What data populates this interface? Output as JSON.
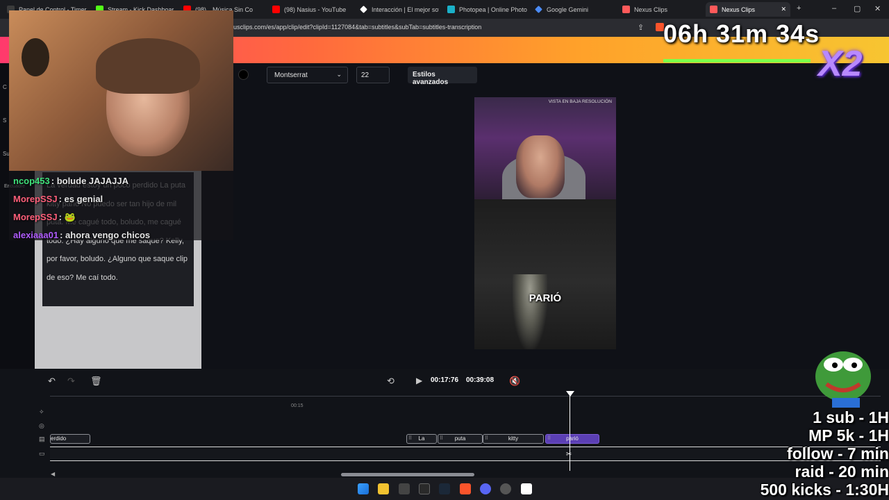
{
  "browser": {
    "tabs": [
      {
        "label": "Panel de Control - Timer",
        "color": "#e8e8e8"
      },
      {
        "label": "Stream - Kick Dashboard",
        "color": "#53fc18"
      },
      {
        "label": "(98)",
        "color": "#ff0000"
      },
      {
        "label": "Música Sin Co",
        "color": "#ff0000"
      },
      {
        "label": "(98) Nasius - YouTube",
        "color": "#ff0000"
      },
      {
        "label": "Interacción | El mejor softw",
        "color": "#ffffff"
      },
      {
        "label": "Photopea | Online Photo E",
        "color": "#1ab0c8"
      },
      {
        "label": "Google Gemini",
        "color": "#4b8bf5"
      },
      {
        "label": "Nexus Clips",
        "color": "#ff5a5a"
      },
      {
        "label": "Nexus Clips",
        "color": "#ff5a5a"
      }
    ],
    "url": "usclips.com/es/app/clip/edit?clipId=1127084&tab=subtitles&subTab=subtitles-transcription"
  },
  "toolbar": {
    "font": "Montserrat",
    "size": "22",
    "advanced_label": "Estilos avanzados"
  },
  "sidebar": {
    "items": [
      "C",
      "S",
      "Su",
      "Encuadre"
    ]
  },
  "transcript": {
    "text": "La verdad estoy un poco perdido La puta kitty parió No puedo ser tan hijo de mil puta. Me cagué todo, boludo, me cagué todo. ¿Hay alguno que me saque? Kelly, por favor, boludo. ¿Alguno que saque clip de eso? Me caí todo."
  },
  "preview": {
    "lowres_label": "VISTA EN BAJA RESOLUCIÓN",
    "caption": "PARIÓ"
  },
  "timeline": {
    "current_time": "00:17:76",
    "total_time": "00:39:08",
    "tick_label": "00:15",
    "words": [
      {
        "text": "erdido",
        "selected": false
      },
      {
        "text": "La",
        "selected": false
      },
      {
        "text": "puta",
        "selected": false
      },
      {
        "text": "kitty",
        "selected": false
      },
      {
        "text": "parió",
        "selected": true
      }
    ]
  },
  "overlay": {
    "timer": "06h 31m 34s",
    "multiplier": "X2",
    "chat": [
      {
        "user": "ncop453",
        "message": ": bolude JAJAJJA",
        "color": "#3fe07a"
      },
      {
        "user": "MorepSSJ",
        "message": ": es genial",
        "color": "#ff5f7a"
      },
      {
        "user": "MorepSSJ",
        "message": ": 🐸",
        "color": "#ff5f7a"
      },
      {
        "user": "alexiaaa01",
        "message": ": ahora vengo chicos",
        "color": "#b05cff"
      }
    ],
    "goals": [
      "1 sub - 1H",
      "MP 5k - 1H",
      "follow - 7 min",
      "raid - 20 min",
      "500 kicks - 1:30H"
    ]
  }
}
